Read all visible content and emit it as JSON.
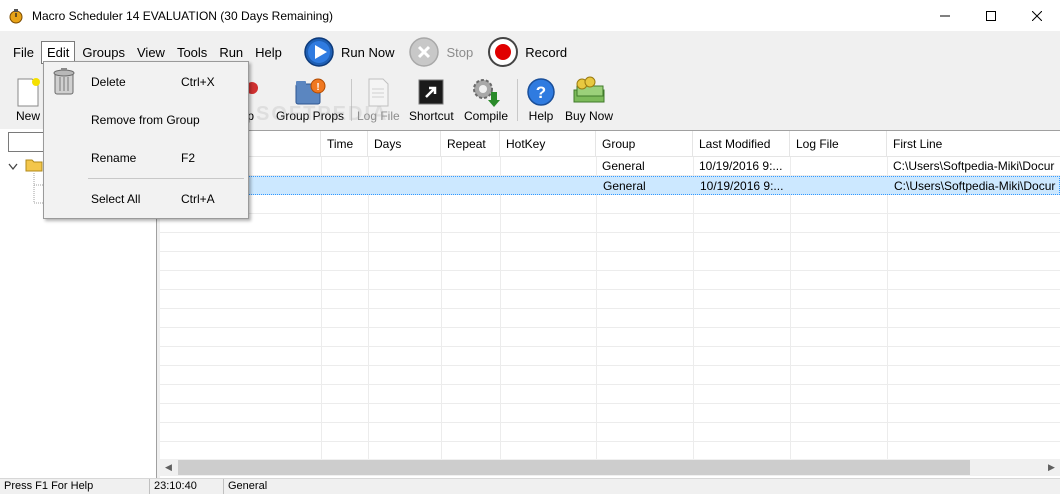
{
  "window": {
    "title": "Macro Scheduler 14 EVALUATION (30 Days Remaining)"
  },
  "menubar": {
    "items": [
      "File",
      "Edit",
      "Groups",
      "View",
      "Tools",
      "Run",
      "Help"
    ]
  },
  "toolbar_top": {
    "run_now": "Run Now",
    "stop": "Stop",
    "record": "Record"
  },
  "toolbar": {
    "new": "New",
    "group": "oup",
    "group_props": "Group Props",
    "log_file": "Log File",
    "shortcut": "Shortcut",
    "compile": "Compile",
    "help": "Help",
    "buy_now": "Buy Now"
  },
  "watermark": "SOFTPEDIA",
  "listview": {
    "columns": [
      "",
      "Time",
      "Days",
      "Repeat",
      "HotKey",
      "Group",
      "Last Modified",
      "Log File",
      "First Line"
    ],
    "rows": [
      {
        "name": "",
        "time": "",
        "days": "",
        "repeat": "",
        "hotkey": "",
        "group": "General",
        "last_modified": "10/19/2016 9:...",
        "log_file": "",
        "first_line": "C:\\Users\\Softpedia-Miki\\Docur"
      },
      {
        "name": "",
        "time": "",
        "days": "",
        "repeat": "",
        "hotkey": "",
        "group": "General",
        "last_modified": "10/19/2016 9:...",
        "log_file": "",
        "first_line": "C:\\Users\\Softpedia-Miki\\Docur"
      }
    ]
  },
  "edit_menu": {
    "items": [
      {
        "label": "Delete",
        "shortcut": "Ctrl+X"
      },
      {
        "label": "Remove from Group",
        "shortcut": ""
      },
      {
        "label": "Rename",
        "shortcut": "F2"
      },
      {
        "label": "Select All",
        "shortcut": "Ctrl+A"
      }
    ]
  },
  "statusbar": {
    "hint": "Press F1 For Help",
    "time": "23:10:40",
    "group": "General"
  },
  "colors": {
    "selection": "#cce8ff",
    "accent_blue": "#1e5fb4",
    "record_red": "#e00000"
  }
}
